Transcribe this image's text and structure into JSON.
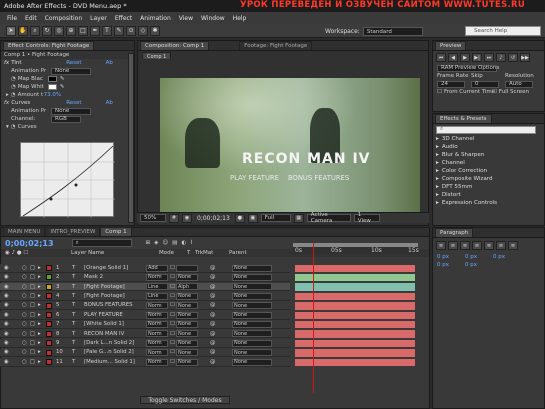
{
  "title_bar": "Adobe After Effects - DVD Menu.aep *",
  "banner": "УРОК ПЕРЕВЕДЕН И ОЗВУЧЕН САЙТОМ WWW.TUTES.RU",
  "menu": [
    "File",
    "Edit",
    "Composition",
    "Layer",
    "Effect",
    "Animation",
    "View",
    "Window",
    "Help"
  ],
  "toolbar": {
    "workspace_label": "Workspace:",
    "workspace_value": "Standard",
    "search_placeholder": "Search Help"
  },
  "effect_controls": {
    "tab_label": "Effect Controls: Fight Footage",
    "subtitle": "Comp 1 • Fight Footage",
    "tint": {
      "name": "Tint",
      "reset": "Reset",
      "about": "Ab",
      "animation_presets_label": "Animation Pr",
      "animation_presets_value": "None",
      "map_black_label": "Map Blac",
      "map_white_label": "Map Whit",
      "amount_label": "Amount t",
      "amount_value": "73.0%"
    },
    "curves": {
      "name": "Curves",
      "reset": "Reset",
      "about": "Ab",
      "animation_presets_label": "Animation Pr",
      "animation_presets_value": "None",
      "channel_label": "Channel:",
      "channel_value": "RGB",
      "curves_label": "Curves"
    }
  },
  "composition": {
    "tab_label": "Composition: Comp 1",
    "footage_tab": "Footage: Fight Footage",
    "comp_tab": "Comp 1",
    "preview_title": "RECON MAN IV",
    "preview_items": [
      "PLAY FEATURE",
      "BONUS FEATURES"
    ],
    "footer": {
      "zoom": "50%",
      "timecode": "0;00;02;13",
      "resolution": "Full",
      "camera": "Active Camera",
      "views": "1 View"
    }
  },
  "timeline": {
    "tabs": [
      "MAIN MENU",
      "INTRO_PREVIEW",
      "Comp 1"
    ],
    "timecode": "0;00;02;13",
    "col_headers": {
      "name": "Layer Name",
      "mode": "Mode",
      "t": "T",
      "trkmat": "TrkMat",
      "parent": "Parent"
    },
    "ruler_labels": [
      "0s",
      "05s",
      "10s",
      "15s"
    ],
    "toggle_label": "Toggle Switches / Modes",
    "layers": [
      {
        "num": "1",
        "color": "#c03030",
        "type": "T",
        "name": "[Orange Solid 1]",
        "mode": "Add",
        "trkmat": "",
        "parent": "None",
        "bar": "#d86a6a"
      },
      {
        "num": "2",
        "color": "#60a040",
        "type": "T",
        "name": "Mask 2",
        "mode": "Norm",
        "trkmat": "None",
        "parent": "None",
        "bar": "#90c890"
      },
      {
        "num": "3",
        "color": "#d0a020",
        "type": "T",
        "name": "[Fight Footage]",
        "mode": "Line",
        "trkmat": "Alph",
        "parent": "None",
        "bar": "#7fbfae"
      },
      {
        "num": "4",
        "color": "#c03030",
        "type": "T",
        "name": "[Fight Footage]",
        "mode": "Line",
        "trkmat": "None",
        "parent": "None",
        "bar": "#d86a6a"
      },
      {
        "num": "5",
        "color": "#c03030",
        "type": "T",
        "name": "BONUS FEATURES",
        "mode": "Norm",
        "trkmat": "None",
        "parent": "None",
        "bar": "#d86a6a"
      },
      {
        "num": "6",
        "color": "#c03030",
        "type": "T",
        "name": "PLAY FEATURE",
        "mode": "Norm",
        "trkmat": "None",
        "parent": "None",
        "bar": "#d86a6a"
      },
      {
        "num": "7",
        "color": "#c03030",
        "type": "T",
        "name": "[White Solid 1]",
        "mode": "Norm",
        "trkmat": "None",
        "parent": "None",
        "bar": "#d86a6a"
      },
      {
        "num": "8",
        "color": "#c03030",
        "type": "T",
        "name": "RECON MAN IV",
        "mode": "Norm",
        "trkmat": "None",
        "parent": "None",
        "bar": "#d86a6a"
      },
      {
        "num": "9",
        "color": "#c03030",
        "type": "T",
        "name": "[Dark L...n Solid 2]",
        "mode": "Norm",
        "trkmat": "None",
        "parent": "None",
        "bar": "#d86a6a"
      },
      {
        "num": "10",
        "color": "#c03030",
        "type": "T",
        "name": "[Pale G...n Solid 2]",
        "mode": "Norm",
        "trkmat": "None",
        "parent": "None",
        "bar": "#d86a6a"
      },
      {
        "num": "11",
        "color": "#c03030",
        "type": "T",
        "name": "[Medium... Solid 1]",
        "mode": "Norm",
        "trkmat": "None",
        "parent": "None",
        "bar": "#d86a6a"
      }
    ]
  },
  "preview_panel": {
    "tab_label": "Preview",
    "ram_preview_label": "RAM Preview Options",
    "frame_rate_label": "Frame Rate",
    "skip_label": "Skip",
    "resolution_label": "Resolution",
    "frame_rate_value": "24",
    "skip_value": "0",
    "resolution_value": "Auto",
    "from_current_label": "From Current Time",
    "full_screen_label": "Full Screen"
  },
  "effects_presets": {
    "tab_label": "Effects & Presets",
    "items": [
      "3D Channel",
      "Audio",
      "Blur & Sharpen",
      "Channel",
      "Color Correction",
      "Composite Wizard",
      "DFT 55mm",
      "Distort",
      "Expression Controls"
    ]
  },
  "paragraph": {
    "tab_label": "Paragraph",
    "fields": [
      "0 px",
      "0 px",
      "0 px",
      "0 px",
      "0 px"
    ]
  }
}
